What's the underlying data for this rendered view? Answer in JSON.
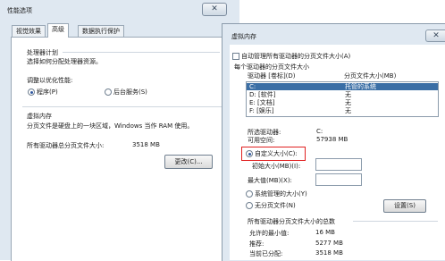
{
  "perf": {
    "title": "性能选项",
    "close": "✕",
    "tabs": [
      "视觉效果",
      "高级",
      "数据执行保护"
    ],
    "processor": {
      "heading": "处理器计划",
      "desc": "选择如何分配处理器资源。",
      "adjust": "调整以优化性能:",
      "opt_programs": "程序(P)",
      "opt_services": "后台服务(S)"
    },
    "vmem": {
      "heading": "虚拟内存",
      "desc": "分页文件是硬盘上的一块区域，Windows 当作 RAM 使用。",
      "total_label": "所有驱动器总分页文件大小:",
      "total_value": "3518 MB",
      "change_btn": "更改(C)..."
    }
  },
  "vm": {
    "title": "虚拟内存",
    "close": "✕",
    "auto_manage": "自动管理所有驱动器的分页文件大小(A)",
    "per_drive_heading": "每个驱动器的分页文件大小",
    "col_drive": "驱动器 [卷标](D)",
    "col_size": "分页文件大小(MB)",
    "drives": [
      {
        "name": "C:",
        "size": "托管的系统"
      },
      {
        "name": "D:   [软件]",
        "size": "无"
      },
      {
        "name": "E:   [文档]",
        "size": "无"
      },
      {
        "name": "F:   [娱乐]",
        "size": "无"
      }
    ],
    "selected_label": "所选驱动器:",
    "selected_value": "C:",
    "free_label": "可用空间:",
    "free_value": "57938 MB",
    "opt_custom": "自定义大小(C):",
    "initial_label": "初始大小(MB)(I):",
    "max_label": "最大值(MB)(X):",
    "opt_system": "系统管理的大小(Y)",
    "opt_none": "无分页文件(N)",
    "set_btn": "设置(S)",
    "totals_heading": "所有驱动器分页文件大小的总数",
    "min_label": "允许的最小值:",
    "min_value": "16 MB",
    "rec_label": "推荐:",
    "rec_value": "5277 MB",
    "cur_label": "当前已分配:",
    "cur_value": "3518 MB"
  }
}
